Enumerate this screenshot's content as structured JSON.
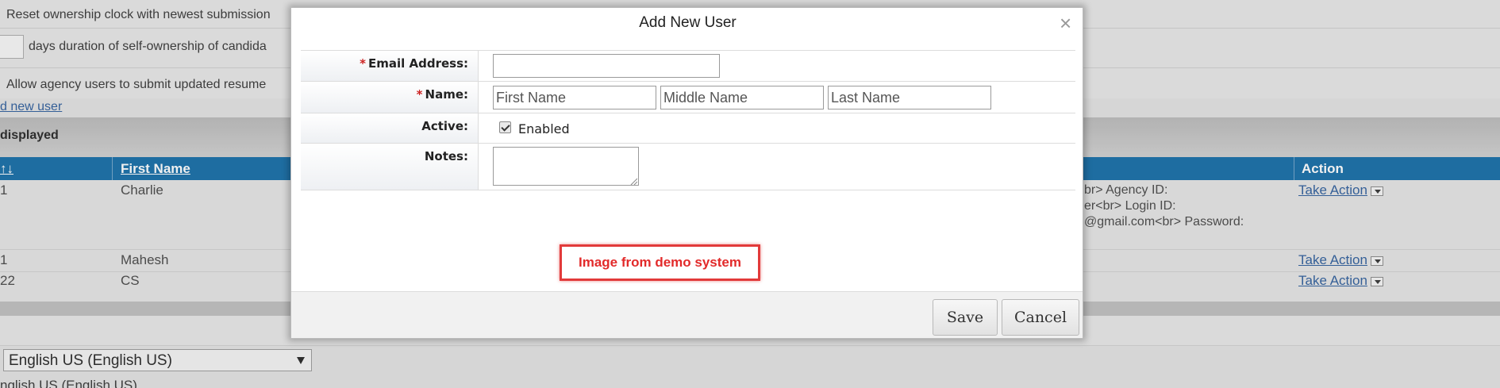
{
  "background": {
    "reset_ownership_text": "Reset ownership clock with newest submission",
    "duration_text": "days duration of self-ownership of candida",
    "allow_agency_text": "Allow agency users to submit updated resume",
    "add_new_user_link": "d new user",
    "displayed_label": "displayed",
    "table": {
      "headers": {
        "first_col": "↑↓",
        "first_name": "First Name",
        "action": "Action"
      },
      "rows": [
        {
          "id": "1",
          "first_name": "Charlie",
          "details": [
            "br> Agency ID:",
            "er<br> Login ID:",
            "@gmail.com<br> Password:"
          ],
          "action": "Take Action"
        },
        {
          "id": "1",
          "first_name": "Mahesh",
          "action": "Take Action"
        },
        {
          "id": "22",
          "first_name": "CS",
          "action": "Take Action"
        }
      ]
    },
    "language_select": "English US (English US)",
    "language_text": "nglish US (English US)"
  },
  "modal": {
    "title": "Add New User",
    "close_glyph": "×",
    "required_mark": "*",
    "email_label": "Email Address:",
    "email_value": "",
    "name_label": "Name:",
    "first_name_placeholder": "First Name",
    "middle_name_placeholder": "Middle Name",
    "last_name_placeholder": "Last Name",
    "active_label": "Active:",
    "active_checked": true,
    "enabled_label": "Enabled",
    "notes_label": "Notes:",
    "notes_value": "",
    "demo_badge": "Image from demo system",
    "save_label": "Save",
    "cancel_label": "Cancel"
  },
  "colors": {
    "table_header_bg": "#106aa6",
    "required_red": "#cc2222",
    "badge_red": "#e23a3a"
  }
}
